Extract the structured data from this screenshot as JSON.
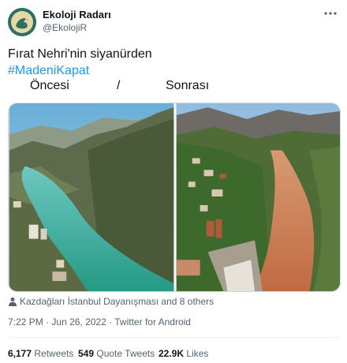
{
  "author": {
    "display_name": "Ekoloji Radarı",
    "handle": "@EkolojiR"
  },
  "tweet": {
    "text": "Fırat Nehri'nin siyanürden",
    "hashtag": "#MadeniKapat",
    "caption_before": "Öncesi",
    "caption_separator": "/",
    "caption_after": "Sonrası"
  },
  "likers": {
    "text": "Kazdağları İstanbul Dayanışması and 8 others"
  },
  "meta": {
    "time": "7:22 PM",
    "date": "Jun 26, 2022",
    "source": "Twitter for Android",
    "separator": "·"
  },
  "stats": {
    "retweets_count": "6,177",
    "retweets_label": "Retweets",
    "quotes_count": "549",
    "quotes_label": "Quote Tweets",
    "likes_count": "22.9K",
    "likes_label": "Likes"
  },
  "colors": {
    "accent": "#1d9bf0",
    "river_before": "#2aa48a",
    "river_after": "#c9704a"
  },
  "icons": {
    "more": "more-horizontal-icon",
    "likers": "person-icon"
  }
}
